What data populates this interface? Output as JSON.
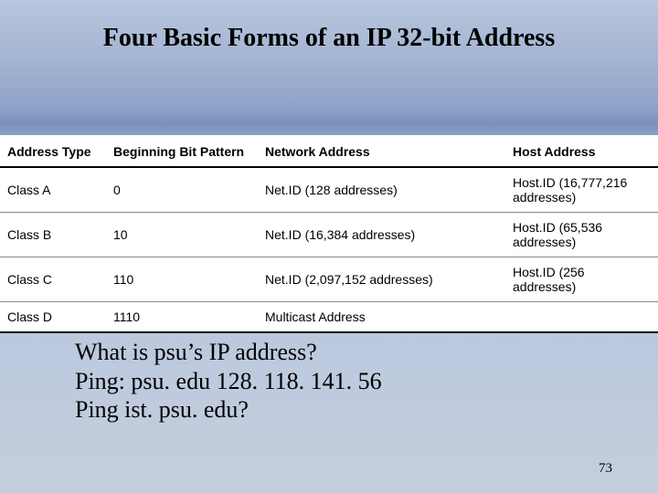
{
  "title": "Four Basic Forms of an IP 32-bit Address",
  "table": {
    "headers": {
      "address_type": "Address Type",
      "beginning_bit": "Beginning Bit Pattern",
      "network_address": "Network Address",
      "host_address": "Host Address"
    },
    "rows": [
      {
        "type": "Class A",
        "bit": "0",
        "net": "Net.ID (128 addresses)",
        "host": "Host.ID (16,777,216 addresses)"
      },
      {
        "type": "Class B",
        "bit": "10",
        "net": "Net.ID (16,384 addresses)",
        "host": "Host.ID (65,536 addresses)"
      },
      {
        "type": "Class C",
        "bit": "110",
        "net": "Net.ID (2,097,152 addresses)",
        "host": "Host.ID (256 addresses)"
      },
      {
        "type": "Class D",
        "bit": "1110",
        "net": "Multicast Address",
        "host": ""
      }
    ]
  },
  "body": {
    "line1": "What is psu’s IP address?",
    "line2": "Ping: psu. edu 128. 118. 141. 56",
    "line3": "Ping ist. psu. edu?"
  },
  "page_number": "73"
}
